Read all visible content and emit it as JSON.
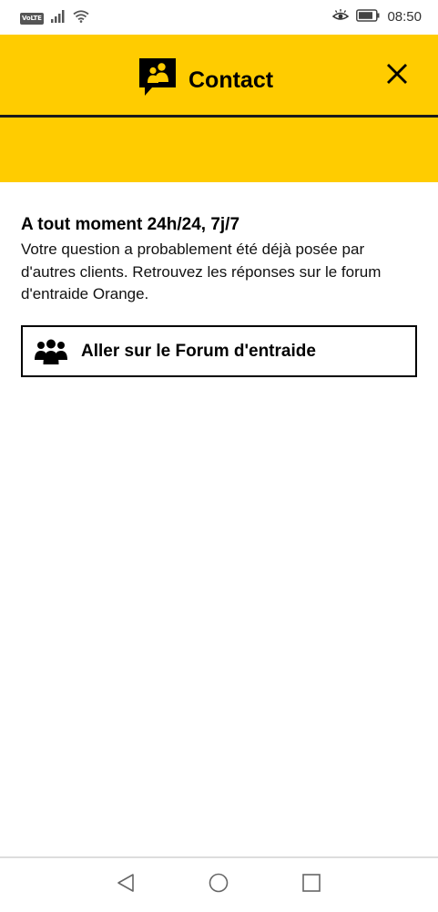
{
  "status_bar": {
    "volte": "VoLTE",
    "time": "08:50",
    "icons": [
      "signal-icon",
      "wifi-icon",
      "eye-comfort-icon",
      "battery-icon"
    ]
  },
  "header": {
    "title": "Contact",
    "icon": "contact-chat-icon",
    "close_icon": "close-icon"
  },
  "content": {
    "title": "A tout moment 24h/24, 7j/7",
    "body": "Votre question a probablement été déjà posée par d'autres clients. Retrouvez les réponses sur le forum d'entraide Orange."
  },
  "forum_button": {
    "label": "Aller sur le Forum d'entraide",
    "icon": "people-group-icon"
  },
  "nav_bar": {
    "icons": [
      "back-icon",
      "home-icon",
      "recents-icon"
    ]
  },
  "colors": {
    "accent": "#ffcc00",
    "text": "#000000",
    "background": "#ffffff"
  }
}
